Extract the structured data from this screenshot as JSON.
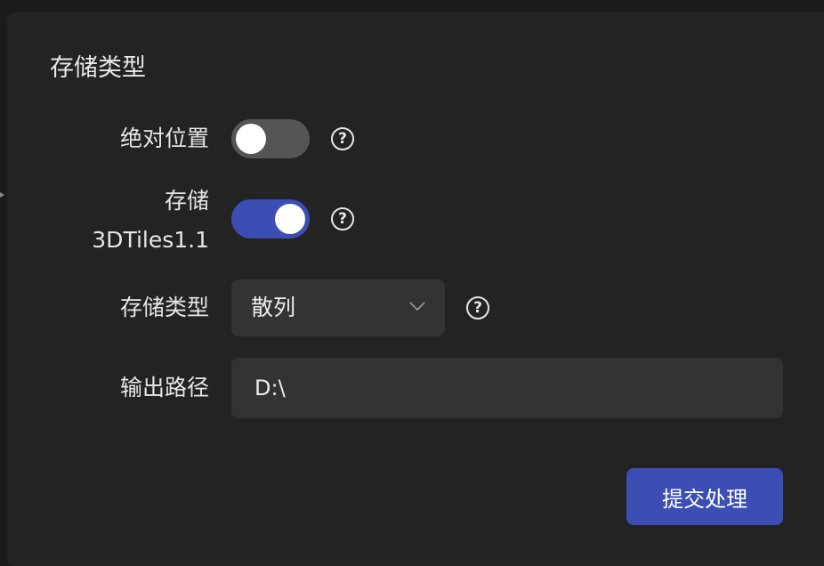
{
  "panel": {
    "title": "存储类型"
  },
  "form": {
    "absolute_position": {
      "label": "绝对位置",
      "enabled": false
    },
    "store_3dtiles": {
      "label_line1": "存储",
      "label_line2": "3DTiles1.1",
      "enabled": true
    },
    "storage_type": {
      "label": "存储类型",
      "value": "散列"
    },
    "output_path": {
      "label": "输出路径",
      "value": "D:\\"
    },
    "help_icon": "question-circle-icon"
  },
  "actions": {
    "submit_label": "提交处理"
  },
  "colors": {
    "accent": "#3c4db3",
    "panel_bg": "#232323",
    "field_bg": "#333333",
    "toggle_off": "#555555"
  }
}
